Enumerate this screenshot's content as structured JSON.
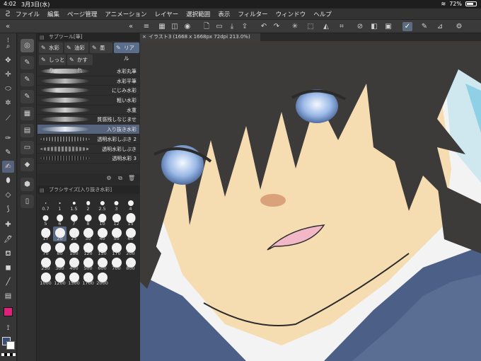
{
  "status": {
    "time": "4:02",
    "date": "3月3日(水)",
    "battery": "72%",
    "battery_level": 0.72
  },
  "menu": [
    "ファイル",
    "編集",
    "ページ管理",
    "アニメーション",
    "レイヤー",
    "選択範囲",
    "表示",
    "フィルター",
    "ウィンドウ",
    "ヘルプ"
  ],
  "subtool": {
    "title": "サブツール[筆]",
    "tabs": [
      "水彩",
      "油彩",
      "墨",
      "リアル",
      "しっとり",
      "かすれ"
    ],
    "active_tab": "リアル",
    "brushes": [
      "水彩丸筆",
      "水彩平筆",
      "にじみ水彩",
      "粗い水彩",
      "水重",
      "質感残しなじませ",
      "入り抜き水彩",
      "透明水彩しぶき 2",
      "透明水彩しぶき",
      "透明水彩 3"
    ],
    "selected_brush": "入り抜き水彩"
  },
  "brushsize": {
    "title": "ブラシサイズ[入り抜き水彩]",
    "sizes": [
      "0.7",
      "1",
      "1.5",
      "2",
      "2.5",
      "3",
      "4",
      "5",
      "6",
      "7",
      "8",
      "10",
      "12",
      "15",
      "17",
      "20",
      "25",
      "30",
      "40",
      "50",
      "60",
      "70",
      "80",
      "100",
      "120",
      "150",
      "170",
      "200",
      "250",
      "300",
      "400",
      "500",
      "600",
      "700",
      "800",
      "1000",
      "1200",
      "1500",
      "1700",
      "2000"
    ],
    "selected": "20"
  },
  "document": {
    "tab_title": "イラスト3 (1668 x 1668px 72dpi 213.0%)"
  },
  "colors": {
    "accent": "#5a6d8b",
    "main_color": "#e0207a",
    "fg": "#3a4f73",
    "bg": "#ffffff",
    "skin": "#f6dcb1",
    "hair": "#3d3a3a",
    "eye": "#a9c4ea",
    "shirt": "#4c5f86"
  }
}
